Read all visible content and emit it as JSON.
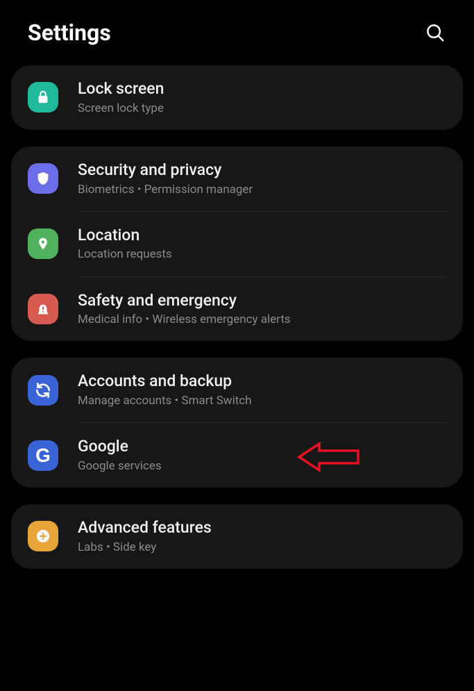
{
  "header": {
    "title": "Settings"
  },
  "groups": [
    {
      "items": [
        {
          "title": "Lock screen",
          "sub": "Screen lock type"
        }
      ]
    },
    {
      "items": [
        {
          "title": "Security and privacy",
          "sub": "Biometrics  •  Permission manager"
        },
        {
          "title": "Location",
          "sub": "Location requests"
        },
        {
          "title": "Safety and emergency",
          "sub": "Medical info  •  Wireless emergency alerts"
        }
      ]
    },
    {
      "items": [
        {
          "title": "Accounts and backup",
          "sub": "Manage accounts  •  Smart Switch"
        },
        {
          "title": "Google",
          "sub": "Google services"
        }
      ]
    },
    {
      "items": [
        {
          "title": "Advanced features",
          "sub": "Labs  •  Side key"
        }
      ]
    }
  ]
}
